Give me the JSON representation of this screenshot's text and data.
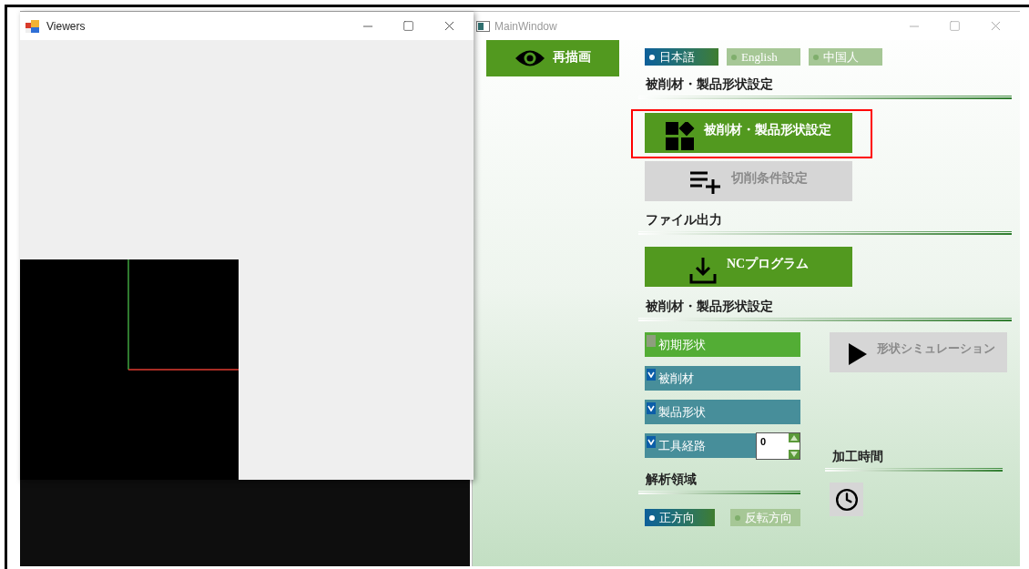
{
  "viewers_window": {
    "title": "Viewers"
  },
  "main_window": {
    "title": "MainWindow",
    "redraw_button": {
      "label": "再描画"
    },
    "language": [
      {
        "label": "日本語",
        "selected": true
      },
      {
        "label": "English",
        "selected": false
      },
      {
        "label": "中国人",
        "selected": false
      }
    ],
    "workpiece_section": {
      "title": "被削材・製品形状設定",
      "buttons": [
        {
          "label": "被削材・製品形状設定",
          "highlighted": true,
          "disabled": false
        },
        {
          "label": "切削条件設定",
          "highlighted": false,
          "disabled": true
        }
      ]
    },
    "file_output": {
      "title": "ファイル出力",
      "button": {
        "label": "NCプログラム",
        "disabled": false
      }
    },
    "display_section": {
      "title": "被削材・製品形状設定",
      "toggles": [
        {
          "label": "初期形状",
          "checked": false
        },
        {
          "label": "被削材",
          "checked": true
        },
        {
          "label": "製品形状",
          "checked": true
        },
        {
          "label": "工具経路",
          "checked": true,
          "spin_value": "0"
        }
      ],
      "simulation_button": {
        "label": "形状シミュレーション",
        "disabled": true
      }
    },
    "analysis": {
      "title": "解析領域",
      "options": [
        {
          "label": "正方向",
          "selected": true
        },
        {
          "label": "反転方向",
          "selected": false
        }
      ]
    },
    "machining_time": {
      "title": "加工時間"
    }
  }
}
